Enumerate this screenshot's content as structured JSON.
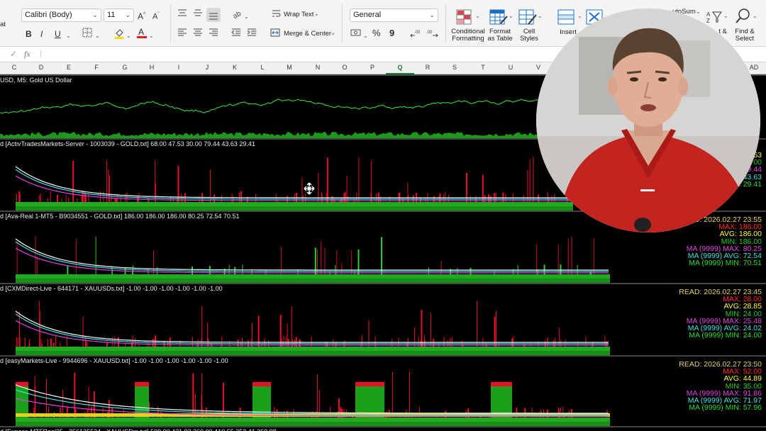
{
  "ribbon": {
    "left_label": "at",
    "font_name": "Calibri (Body)",
    "font_size": "11",
    "bold": "B",
    "italic": "I",
    "underline": "U",
    "wrap_text": "Wrap Text",
    "merge_center": "Merge & Center",
    "number_format": "General",
    "percent": "%",
    "comma": "9",
    "conditional_formatting": "Conditional\nFormatting",
    "format_as_table": "Format\nas Table",
    "cell_styles": "Cell\nStyles",
    "insert": "Insert",
    "autosum": "utoSum",
    "sort_filter": "t &",
    "find_select": "Find &\nSelect"
  },
  "formula_bar": {
    "fx": "fx",
    "check": "✓"
  },
  "columns": [
    {
      "l": "C"
    },
    {
      "l": "D"
    },
    {
      "l": "E"
    },
    {
      "l": "F"
    },
    {
      "l": "G"
    },
    {
      "l": "H"
    },
    {
      "l": "I"
    },
    {
      "l": "J"
    },
    {
      "l": "K"
    },
    {
      "l": "L"
    },
    {
      "l": "M"
    },
    {
      "l": "N"
    },
    {
      "l": "O"
    },
    {
      "l": "P"
    },
    {
      "l": "Q"
    },
    {
      "l": "R"
    },
    {
      "l": "S"
    },
    {
      "l": "T"
    },
    {
      "l": "U"
    },
    {
      "l": "V"
    },
    {
      "l": "AD"
    }
  ],
  "selected_column": "Q",
  "colors": {
    "max": "#ff2a2a",
    "avg": "#ffff33",
    "min": "#22cc22",
    "ma_max": "#e040e0",
    "ma_avg": "#40e0e0",
    "ma_min": "#22dd22",
    "read": "#e6d35a",
    "price_line": "#38e838"
  },
  "panels": [
    {
      "title": "USD, M5:  Gold US Dollar"
    },
    {
      "title": "d [ActivTradesMarkets-Server - 1003039 - GOLD.txt] 68.00 47.53 30.00 79.44 43.63 29.41",
      "stats": [
        {
          "t": "53",
          "c": "avg"
        },
        {
          "t": "00",
          "c": "min"
        },
        {
          "t": "79.44",
          "c": "ma_max"
        },
        {
          "t": "43.63",
          "c": "ma_avg"
        },
        {
          "t": "MIN: 29.41",
          "c": "ma_min"
        }
      ]
    },
    {
      "title": "d [Ava-Real 1-MT5 - B9034551 - GOLD.txt] 186.00 186.00 186.00 80.25 72.54 70.51",
      "stats": [
        {
          "t": "READ: 2026.02.27 23:55",
          "c": "read"
        },
        {
          "t": "MAX: 186.00",
          "c": "max"
        },
        {
          "t": "AVG: 186.00",
          "c": "avg"
        },
        {
          "t": "MIN: 186.00",
          "c": "min"
        },
        {
          "t": "MA (9999) MAX: 80.25",
          "c": "ma_max"
        },
        {
          "t": "MA (9999) AVG: 72.54",
          "c": "ma_avg"
        },
        {
          "t": "MA (9999) MIN: 70.51",
          "c": "ma_min"
        }
      ]
    },
    {
      "title": "d [CXMDirect-Live - 644171 - XAUUSDs.txt] -1.00 -1.00 -1.00 -1.00 -1.00 -1.00",
      "stats": [
        {
          "t": "READ: 2026.02.27 23:45",
          "c": "read"
        },
        {
          "t": "MAX: 28.00",
          "c": "max"
        },
        {
          "t": "AVG: 28.85",
          "c": "avg"
        },
        {
          "t": "MIN: 24.00",
          "c": "min"
        },
        {
          "t": "MA (9999) MAX: 25.48",
          "c": "ma_max"
        },
        {
          "t": "MA (9999) AVG: 24.02",
          "c": "ma_avg"
        },
        {
          "t": "MA (9999) MIN: 24.00",
          "c": "ma_min"
        }
      ]
    },
    {
      "title": "d [easyMarkets-Live - 9944696 - XAUUSD.txt] -1.00 -1.00 -1.00 -1.00 -1.00 -1.00",
      "stats": [
        {
          "t": "READ: 2026.02.27 23:50",
          "c": "read"
        },
        {
          "t": "MAX: 52.00",
          "c": "max"
        },
        {
          "t": "AVG: 44.89",
          "c": "avg"
        },
        {
          "t": "MIN: 35.00",
          "c": "min"
        },
        {
          "t": "MA (9999) MAX: 91.86",
          "c": "ma_max"
        },
        {
          "t": "MA (9999) AVG: 71.97",
          "c": "ma_avg"
        },
        {
          "t": "MA (9999) MIN: 57.96",
          "c": "ma_min"
        }
      ]
    },
    {
      "title": "d [Exness-MT5Real25 - 256135524 - XAUUSDm.txt] 500.00 421.93 360.00 410.55 353.41 269.98"
    }
  ]
}
